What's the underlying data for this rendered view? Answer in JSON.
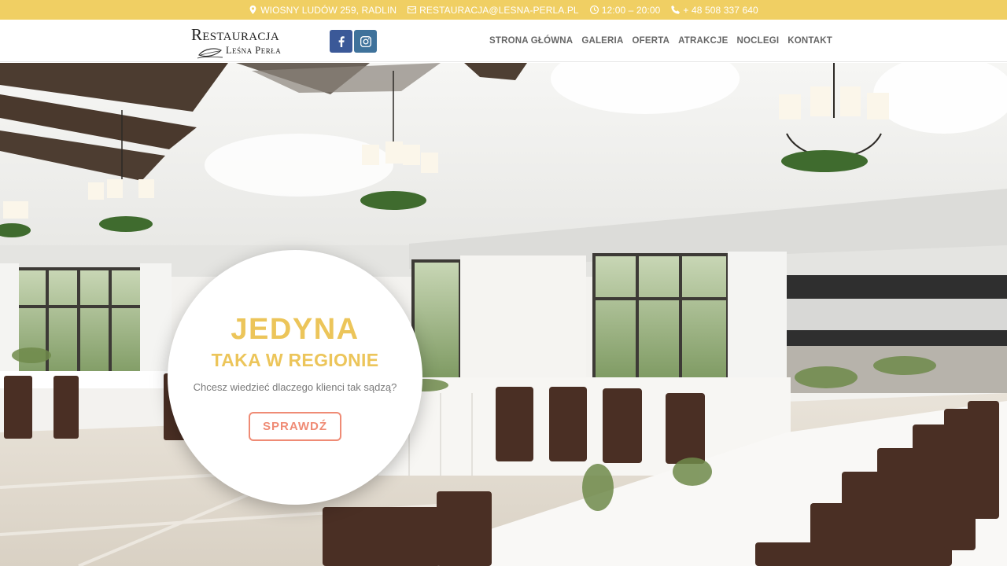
{
  "topbar": {
    "address": "WIOSNY LUDÓW 259, RADLIN",
    "email": "RESTAURACJA@LESNA-PERLA.PL",
    "hours": "12:00 – 20:00",
    "phone": "+ 48 508 337 640"
  },
  "logo": {
    "title": "Restauracja",
    "subtitle": "Leśna Perła"
  },
  "social": [
    "facebook-icon",
    "instagram-icon"
  ],
  "nav": {
    "items": [
      {
        "label": "STRONA GŁÓWNA"
      },
      {
        "label": "GALERIA"
      },
      {
        "label": "OFERTA"
      },
      {
        "label": "ATRAKCJE"
      },
      {
        "label": "NOCLEGI"
      },
      {
        "label": "KONTAKT"
      }
    ]
  },
  "hero": {
    "title": "JEDYNA",
    "subtitle": "TAKA W REGIONIE",
    "text": "Chcesz wiedzieć dlaczego klienci tak sądzą?",
    "button": "SPRAWDŹ"
  },
  "colors": {
    "topbar": "#f0cf63",
    "accent_gold": "#ecc55a",
    "button_coral": "#ef8b75",
    "facebook": "#3b5998",
    "instagram": "#3f729b"
  }
}
